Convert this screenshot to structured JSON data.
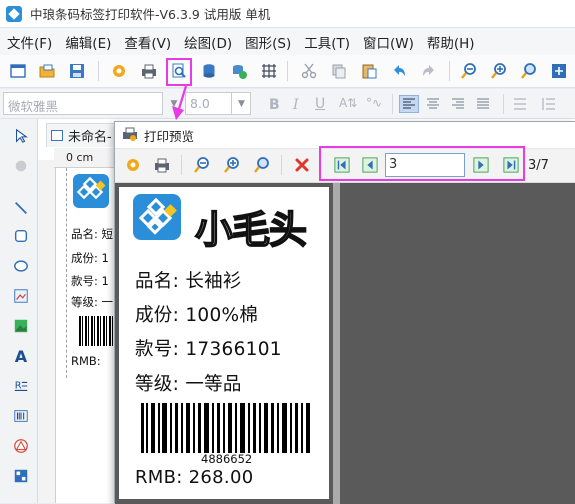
{
  "app": {
    "title": "中琅条码标签打印软件-V6.3.9 试用版 单机"
  },
  "menu": [
    "文件(F)",
    "编辑(E)",
    "查看(V)",
    "绘图(D)",
    "图形(S)",
    "工具(T)",
    "窗口(W)",
    "帮助(H)"
  ],
  "format_bar": {
    "font_placeholder": "微软雅黑",
    "size_value": "8.0"
  },
  "document": {
    "tab_label": "未命名-",
    "ruler_unit": "0 cm",
    "behind_lines": [
      "品名: 短",
      "成份: 1",
      "款号: 1",
      "等级: 一",
      "RMB:"
    ]
  },
  "preview": {
    "title": "打印预览",
    "page_value": "3",
    "page_count": "3/7"
  },
  "label": {
    "logo_text": "小毛头",
    "lines": [
      "品名: 长袖衫",
      "成份: 100%棉",
      "款号: 17366101",
      "等级: 一等品"
    ],
    "barcode_number": "4886652",
    "price_line": "RMB:  268.00"
  },
  "colors": {
    "highlight": "#e83ae5",
    "accent_blue": "#2a8fd8",
    "preview_bg": "#5a5a5a"
  },
  "icons": {
    "toolbar": [
      "new-icon",
      "open-icon",
      "save-icon",
      "settings-icon",
      "print-icon",
      "print-preview-icon",
      "database-icon",
      "database-link-icon",
      "grid-icon",
      "cut-icon",
      "copy-icon",
      "paste-icon",
      "undo-icon",
      "redo-icon",
      "zoom-out-icon",
      "zoom-in-icon",
      "zoom-icon",
      "fit-page-icon"
    ]
  }
}
